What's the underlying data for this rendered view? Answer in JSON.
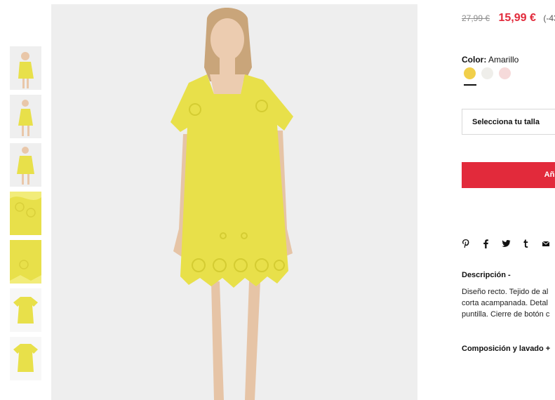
{
  "product": {
    "old_price": "27,99 €",
    "new_price": "15,99 €",
    "discount": "(-43",
    "color_label": "Color:",
    "color_value": "Amarillo",
    "swatch_colors": [
      "#f1cf4a",
      "#efeeea",
      "#f6dada"
    ],
    "size_placeholder": "Selecciona tu talla",
    "add_button_label": "Añ"
  },
  "share": {
    "icons": [
      "pinterest-icon",
      "facebook-icon",
      "twitter-icon",
      "tumblr-icon",
      "mail-icon"
    ],
    "glyphs": [
      "℗",
      "f",
      "𝕥",
      "t",
      "✉"
    ]
  },
  "description": {
    "title": "Descripción -",
    "lines": [
      "Diseño recto. Tejido de al",
      "corta acampanada. Detal",
      "puntilla. Cierre de botón c"
    ]
  },
  "composition": {
    "title": "Composición y lavado +"
  },
  "colors": {
    "accent": "#e22a3b",
    "dress": "#e8e04a",
    "image_bg": "#eeeeee"
  }
}
